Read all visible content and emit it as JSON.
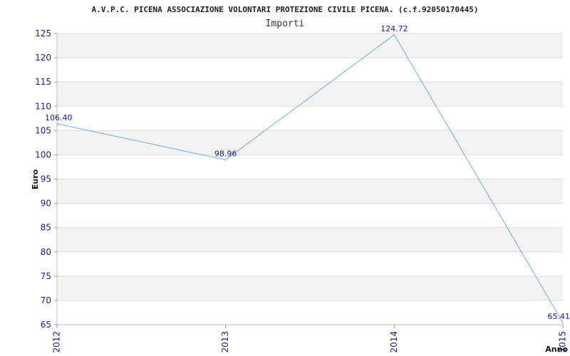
{
  "chart_data": {
    "type": "line",
    "title": "A.V.P.C. PICENA ASSOCIAZIONE VOLONTARI PROTEZIONE CIVILE PICENA. (c.f.92050170445)",
    "subtitle": "Importi",
    "xlabel": "Anno",
    "ylabel": "Euro",
    "categories": [
      "2012",
      "2013",
      "2014",
      "2015"
    ],
    "series": [
      {
        "values": [
          106.4,
          98.96,
          124.72,
          65.41
        ],
        "labels": [
          "106.40",
          "98.96",
          "124.72",
          "65.41"
        ]
      }
    ],
    "ylim": [
      65,
      125
    ],
    "yticks": [
      65,
      70,
      75,
      80,
      85,
      90,
      95,
      100,
      105,
      110,
      115,
      120,
      125
    ],
    "grid": true,
    "colors": {
      "line": "#6aaeea",
      "band_alt": "#f3f3f3",
      "grid": "#dddddd",
      "tick_text": "#1a1a99"
    }
  }
}
